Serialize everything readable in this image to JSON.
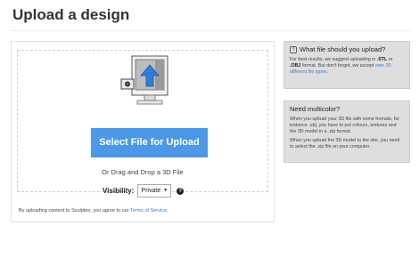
{
  "page": {
    "title": "Upload a design"
  },
  "upload": {
    "button_label": "Select File for Upload",
    "drag_text": "Or Drag and Drop a 3D File",
    "visibility_label": "Visibility:",
    "visibility_value": "Private",
    "help_icon": "question-circle-icon",
    "tos_prefix": "By uploading content to Sculpteo, you agree to our ",
    "tos_link": "Terms of Service",
    "tos_suffix": "."
  },
  "sidebar": {
    "file_card": {
      "icon_glyph": "?",
      "title": "What file should you upload?",
      "text_a": "For best results, we suggest uploading in ",
      "ext_stl": ".STL",
      "text_b": " or ",
      "ext_obj": ".OBJ",
      "text_c": " format. But don't forget, we accept ",
      "link_text": "over 20 different file types",
      "text_d": "."
    },
    "color_card": {
      "title": "Need multicolor?",
      "p1": "When you upload your 3D file with some formats, for instance .obj, you have to put colours, textures and the 3D model in a .zip format.",
      "p2": "When you upload the 3D model to the site, you need to select the .zip file on your computer."
    }
  },
  "colors": {
    "accent": "#4d97e9",
    "link": "#3a80cc",
    "card_bg": "#dedede"
  }
}
